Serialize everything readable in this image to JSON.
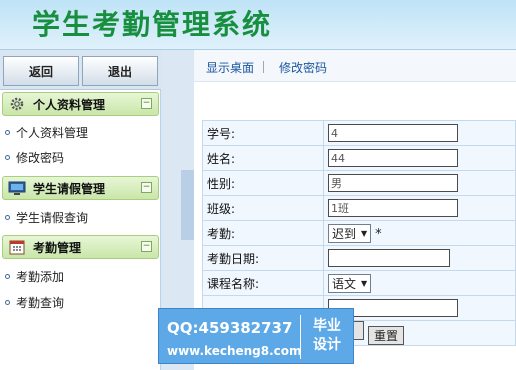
{
  "header": {
    "title": "学生考勤管理系统"
  },
  "sidebar": {
    "buttons": {
      "back": "返回",
      "exit": "退出"
    },
    "sections": [
      {
        "title": "个人资料管理",
        "icon": "gear-icon",
        "items": [
          "个人资料管理",
          "修改密码"
        ]
      },
      {
        "title": "学生请假管理",
        "icon": "monitor-icon",
        "items": [
          "学生请假查询"
        ]
      },
      {
        "title": "考勤管理",
        "icon": "calendar-icon",
        "items": [
          "考勤添加",
          "考勤查询"
        ]
      }
    ],
    "collapse_symbol": "−"
  },
  "topnav": {
    "links": [
      "显示桌面",
      "修改密码"
    ]
  },
  "form": {
    "fields": {
      "student_id": {
        "label": "学号:",
        "value": "4"
      },
      "name": {
        "label": "姓名:",
        "value": "44"
      },
      "gender": {
        "label": "性别:",
        "value": "男"
      },
      "class": {
        "label": "班级:",
        "value": "1班"
      },
      "attendance": {
        "label": "考勤:",
        "selected": "迟到",
        "required": "*"
      },
      "date": {
        "label": "考勤日期:",
        "value": ""
      },
      "course": {
        "label": "课程名称:",
        "selected": "语文"
      }
    },
    "buttons": {
      "reset": "重置"
    }
  },
  "watermark": {
    "qq": "QQ:459382737",
    "url": "www.kecheng8.com",
    "badge_line1": "毕业",
    "badge_line2": "设计"
  },
  "colors": {
    "title": "#178f3e",
    "link": "#1a57a0",
    "section_bg": "#d6eebd",
    "watermark_bg": "#5da8e6"
  }
}
